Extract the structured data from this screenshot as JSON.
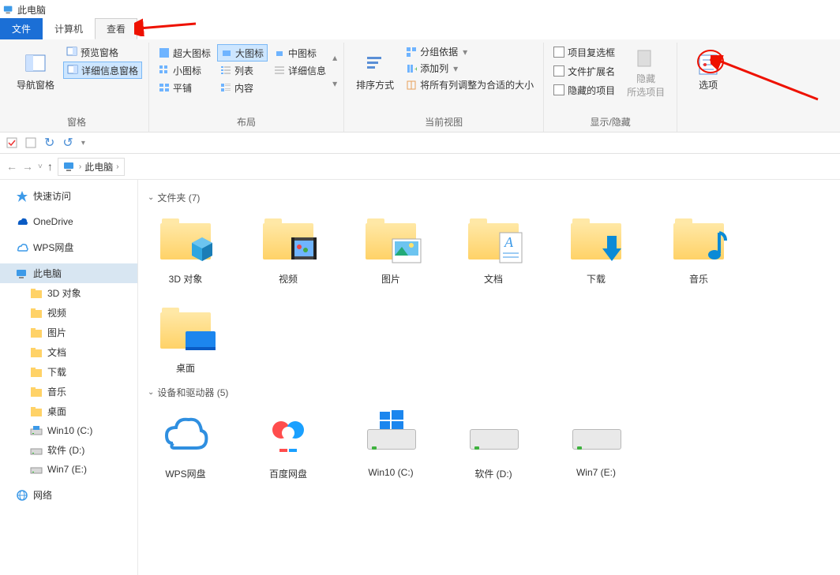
{
  "window": {
    "title": "此电脑"
  },
  "tabs": {
    "file": "文件",
    "computer": "计算机",
    "view": "查看"
  },
  "ribbon": {
    "panes": {
      "nav_pane": "导航窗格",
      "preview_pane": "预览窗格",
      "details_pane": "详细信息窗格",
      "group_label": "窗格"
    },
    "layout": {
      "extra_large": "超大图标",
      "large": "大图标",
      "medium": "中图标",
      "small": "小图标",
      "list": "列表",
      "details": "详细信息",
      "tiles": "平铺",
      "content": "内容",
      "group_label": "布局"
    },
    "current_view": {
      "sort_by": "排序方式",
      "group_by": "分组依据",
      "add_columns": "添加列",
      "fit_columns": "将所有列调整为合适的大小",
      "group_label": "当前视图"
    },
    "show_hide": {
      "item_checkboxes": "项目复选框",
      "file_ext": "文件扩展名",
      "hidden_items": "隐藏的项目",
      "hide_selected": "隐藏\n所选项目",
      "group_label": "显示/隐藏"
    },
    "options": "选项"
  },
  "breadcrumb": {
    "root": "此电脑"
  },
  "sidebar": {
    "quick_access": "快速访问",
    "onedrive": "OneDrive",
    "wps": "WPS网盘",
    "this_pc": "此电脑",
    "subitems": {
      "objects3d": "3D 对象",
      "videos": "视频",
      "pictures": "图片",
      "documents": "文档",
      "downloads": "下载",
      "music": "音乐",
      "desktop": "桌面",
      "drive_c": "Win10 (C:)",
      "drive_d": "软件 (D:)",
      "drive_e": "Win7 (E:)"
    },
    "network": "网络"
  },
  "content": {
    "section_folders": "文件夹 (7)",
    "section_drives": "设备和驱动器 (5)",
    "folders": {
      "objects3d": "3D 对象",
      "videos": "视频",
      "pictures": "图片",
      "documents": "文档",
      "downloads": "下载",
      "music": "音乐",
      "desktop": "桌面"
    },
    "drives": {
      "wps": "WPS网盘",
      "baidu": "百度网盘",
      "c": "Win10 (C:)",
      "d": "软件 (D:)",
      "e": "Win7 (E:)"
    }
  }
}
